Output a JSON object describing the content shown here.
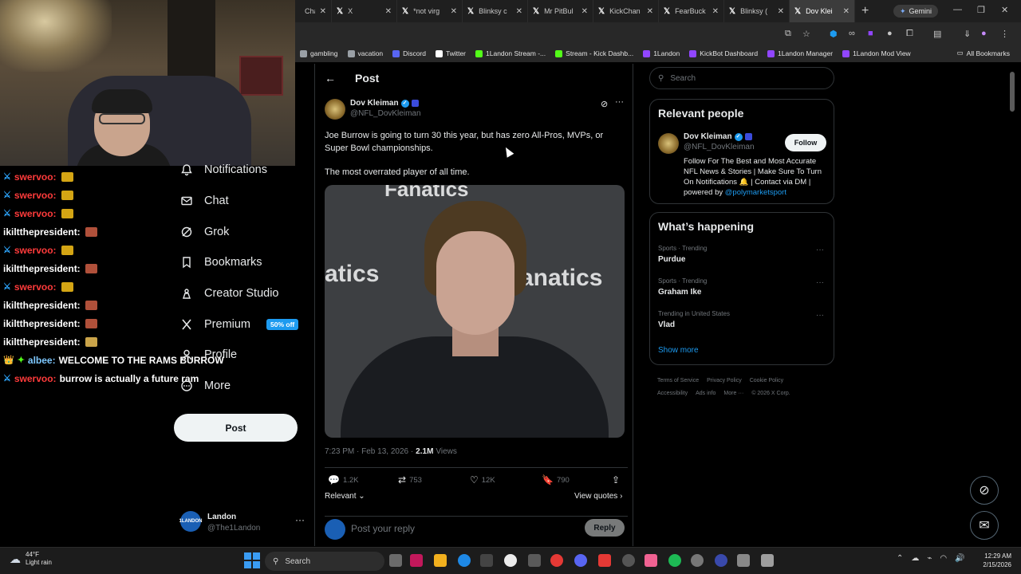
{
  "browser": {
    "tabs": [
      {
        "label": "Chan",
        "icon": "kick-icon"
      },
      {
        "label": "X",
        "icon": "x-icon"
      },
      {
        "label": "*not virg",
        "icon": "x-icon"
      },
      {
        "label": "Blinksy c",
        "icon": "x-icon"
      },
      {
        "label": "Mr PitBul",
        "icon": "x-icon"
      },
      {
        "label": "KickChan",
        "icon": "x-icon"
      },
      {
        "label": "FearBuck",
        "icon": "x-icon"
      },
      {
        "label": "Blinksy (",
        "icon": "x-icon"
      },
      {
        "label": "Dov Klei",
        "icon": "x-icon",
        "active": true
      }
    ],
    "gemini_label": "Gemini",
    "bookmarks": [
      {
        "label": "gambling",
        "color": "#9aa0a6"
      },
      {
        "label": "vacation",
        "color": "#9aa0a6"
      },
      {
        "label": "Discord",
        "color": "#5865f2"
      },
      {
        "label": "Twitter",
        "color": "#ffffff"
      },
      {
        "label": "1Landon Stream -...",
        "color": "#53fc18"
      },
      {
        "label": "Stream - Kick Dashb...",
        "color": "#53fc18"
      },
      {
        "label": "1Landon",
        "color": "#9146ff"
      },
      {
        "label": "KickBot Dashboard",
        "color": "#9146ff"
      },
      {
        "label": "1Landon Manager",
        "color": "#9146ff"
      },
      {
        "label": "1Landon Mod View",
        "color": "#9146ff"
      }
    ],
    "all_bookmarks_label": "All Bookmarks"
  },
  "chat": [
    {
      "user": "swervoo:",
      "color": "#ff3b3b",
      "msg": "",
      "emote": "#d4a514",
      "badge": true
    },
    {
      "user": "swervoo:",
      "color": "#ff3b3b",
      "msg": "",
      "emote": "#d4a514",
      "badge": true
    },
    {
      "user": "swervoo:",
      "color": "#ff3b3b",
      "msg": "",
      "emote": "#d4a514",
      "badge": true
    },
    {
      "user": "ikiltthepresident:",
      "color": "#ffffff",
      "msg": "",
      "emote": "#b0503a",
      "badge": false
    },
    {
      "user": "swervoo:",
      "color": "#ff3b3b",
      "msg": "",
      "emote": "#d4a514",
      "badge": true
    },
    {
      "user": "ikiltthepresident:",
      "color": "#ffffff",
      "msg": "",
      "emote": "#b0503a",
      "badge": false
    },
    {
      "user": "swervoo:",
      "color": "#ff3b3b",
      "msg": "",
      "emote": "#d4a514",
      "badge": true
    },
    {
      "user": "ikiltthepresident:",
      "color": "#ffffff",
      "msg": "",
      "emote": "#b0503a",
      "badge": false
    },
    {
      "user": "ikiltthepresident:",
      "color": "#ffffff",
      "msg": "",
      "emote": "#b0503a",
      "badge": false
    },
    {
      "user": "ikiltthepresident:",
      "color": "#ffffff",
      "msg": "",
      "emote": "#caa44a",
      "badge": false
    },
    {
      "user": "albee:",
      "color": "#7ec8ff",
      "msg": "WELCOME TO THE RAMS BURROW",
      "emote": "",
      "badge": false,
      "crown": true
    },
    {
      "user": "swervoo:",
      "color": "#ff3b3b",
      "msg": "burrow is actually a future ram",
      "emote": "",
      "badge": true
    }
  ],
  "nav": {
    "items": [
      {
        "label": "Notifications",
        "icon": "bell-icon"
      },
      {
        "label": "Chat",
        "icon": "mail-icon"
      },
      {
        "label": "Grok",
        "icon": "grok-icon"
      },
      {
        "label": "Bookmarks",
        "icon": "bookmark-icon"
      },
      {
        "label": "Creator Studio",
        "icon": "creator-icon"
      },
      {
        "label": "Premium",
        "icon": "x-logo-icon"
      },
      {
        "label": "Profile",
        "icon": "profile-icon"
      },
      {
        "label": "More",
        "icon": "more-circle-icon"
      }
    ],
    "premium_badge": "50% off",
    "post_button": "Post",
    "account": {
      "name": "Landon",
      "handle": "@The1Landon",
      "avatar_text": "1LANDON"
    }
  },
  "post": {
    "header": "Post",
    "author_name": "Dov Kleiman",
    "author_handle": "@NFL_DovKleiman",
    "text": "Joe Burrow is going to turn 30 this year, but has zero All-Pros, MVPs, or Super Bowl championships.",
    "text2": "The most overrated player of all time.",
    "image_text_left": "atics",
    "image_text_right": "anatics",
    "image_text_top": "Fanatics",
    "timestamp": "7:23 PM · Feb 13, 2026 ·",
    "views_count": "2.1M",
    "views_label": "Views",
    "replies": "1.2K",
    "reposts": "753",
    "likes": "12K",
    "bookmarks": "790",
    "relevant_label": "Relevant",
    "view_quotes_label": "View quotes",
    "reply_placeholder": "Post your reply",
    "reply_button": "Reply"
  },
  "sidebar": {
    "search_placeholder": "Search",
    "relevant_title": "Relevant people",
    "person_name": "Dov Kleiman",
    "person_handle": "@NFL_DovKleiman",
    "follow_label": "Follow",
    "bio": "Follow For The Best and Most Accurate NFL News & Stories | Make Sure To Turn On Notifications 🔔 | Contact via DM | powered by",
    "bio_link": "@polymarketsport",
    "happening_title": "What’s happening",
    "trends": [
      {
        "category": "Sports · Trending",
        "name": "Purdue"
      },
      {
        "category": "Sports · Trending",
        "name": "Graham Ike"
      },
      {
        "category": "Trending in United States",
        "name": "Vlad"
      }
    ],
    "show_more": "Show more",
    "footer": [
      "Terms of Service",
      "Privacy Policy",
      "Cookie Policy",
      "Accessibility",
      "Ads info",
      "More ···",
      "© 2026 X Corp."
    ]
  },
  "taskbar": {
    "weather_temp": "44°F",
    "weather_desc": "Light rain",
    "search_label": "Search",
    "time": "12:29 AM",
    "date": "2/15/2026"
  }
}
